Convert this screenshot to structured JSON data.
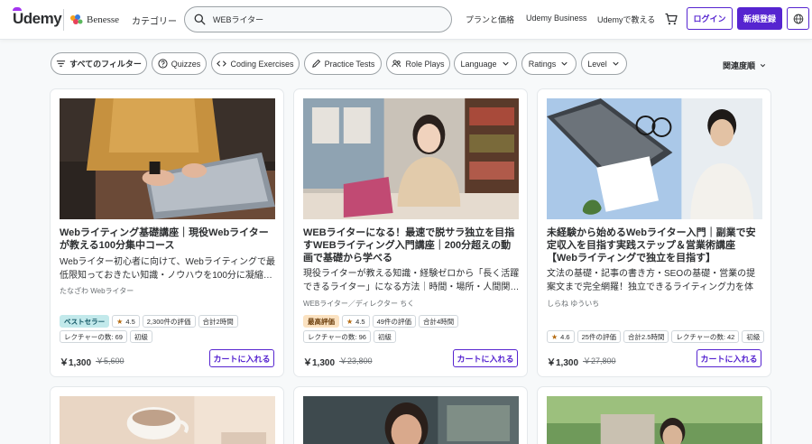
{
  "header": {
    "logo": "Udemy",
    "partner": "Benesse",
    "category": "カテゴリー",
    "search_value": "WEBライター",
    "links": [
      "プランと価格",
      "Udemy Business",
      "Udemyで教える"
    ],
    "login": "ログイン",
    "signup": "新規登録",
    "icons": {
      "search": "search-icon",
      "cart": "cart-icon",
      "language": "globe-icon"
    }
  },
  "filters": {
    "all": "すべてのフィルター",
    "chips": [
      "Quizzes",
      "Coding Exercises",
      "Practice Tests",
      "Role Plays"
    ],
    "dropdowns": [
      "Language",
      "Ratings",
      "Level"
    ],
    "sort": "関連度順"
  },
  "courses": [
    {
      "title": "Webライティング基礎講座｜現役Webライターが教える100分集中コース",
      "desc": "Webライター初心者に向けて、Webライティングで最低限知っておきたい知識・ノウハウを100分に凝縮…",
      "instructor": "たなざわ Webライター",
      "badge": "ベストセラー",
      "rating": "4.5",
      "reviews": "2,300件の評価",
      "hours": "合計2時間",
      "lectures": "レクチャーの数: 69",
      "level": "初級",
      "price": "￥1,300",
      "old_price": "￥5,600",
      "cart": "カートに入れる"
    },
    {
      "title": "WEBライターになる！最速で脱サラ独立を目指すWEBライティング入門講座｜200分超えの動画で基礎から学べる",
      "desc": "現役ライターが教える知識・経験ゼロから「長く活躍できるライター」になる方法｜時間・場所・人間関…",
      "instructor": "WEBライター／ディレクター ちく",
      "badge": "最高評価",
      "rating": "4.5",
      "reviews": "49件の評価",
      "hours": "合計4時間",
      "lectures": "レクチャーの数: 96",
      "level": "初級",
      "price": "￥1,300",
      "old_price": "￥23,800",
      "cart": "カートに入れる"
    },
    {
      "title": "未経験から始めるWebライター入門｜副業で安定収入を目指す実践ステップ＆営業術講座【Webライティングで独立を目指す】",
      "desc": "文法の基礎・記事の書き方・SEOの基礎・営業の提案文まで完全網羅！独立できるライティング力を体系…",
      "instructor": "しらね ゆういち",
      "badge": "",
      "rating": "4.6",
      "reviews": "25件の評価",
      "hours": "合計2.5時間",
      "lectures": "レクチャーの数: 42",
      "level": "初級",
      "price": "￥1,300",
      "old_price": "￥27,800",
      "cart": "カートに入れる"
    }
  ]
}
